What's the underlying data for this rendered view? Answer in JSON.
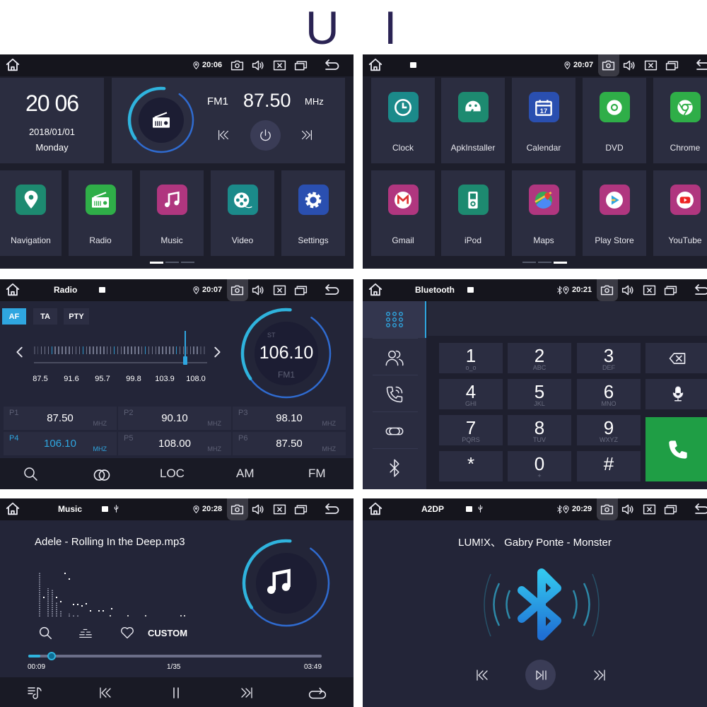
{
  "header": {
    "letters": [
      "U",
      "I"
    ]
  },
  "colors": {
    "accent": "#2fa6e0",
    "call_green": "#1f9e45",
    "status_bar": "#15151d",
    "background": "#232538",
    "tile": "#2b2d40"
  },
  "home": {
    "status": {
      "time": "20:06",
      "title": ""
    },
    "clock": {
      "time": "20 06",
      "date": "2018/01/01",
      "day": "Monday"
    },
    "radio_widget": {
      "band": "FM1",
      "frequency": "87.50",
      "unit": "MHz"
    },
    "apps": [
      {
        "label": "Navigation",
        "icon": "location-pin-icon",
        "color": "#1d8a70"
      },
      {
        "label": "Radio",
        "icon": "radio-icon",
        "color": "#2fae48"
      },
      {
        "label": "Music",
        "icon": "music-note-icon",
        "color": "#b0367f"
      },
      {
        "label": "Video",
        "icon": "film-reel-icon",
        "color": "#1b8a8a"
      },
      {
        "label": "Settings",
        "icon": "gear-icon",
        "color": "#2a4fb0"
      }
    ],
    "page_indicator": {
      "pages": 3,
      "active": 0
    }
  },
  "apps_page": {
    "status": {
      "time": "20:07",
      "title": ""
    },
    "apps": [
      {
        "label": "Clock",
        "icon": "clock-icon",
        "color": "#1b8a8a"
      },
      {
        "label": "ApkInstaller",
        "icon": "android-icon",
        "color": "#1d8a70"
      },
      {
        "label": "Calendar",
        "icon": "calendar-icon",
        "color": "#2a4fb0",
        "badge": "17"
      },
      {
        "label": "DVD",
        "icon": "disc-icon",
        "color": "#2fae48"
      },
      {
        "label": "Chrome",
        "icon": "chrome-icon",
        "color": "#2fae48"
      },
      {
        "label": "Gmail",
        "icon": "gmail-icon",
        "color": "#b0367f"
      },
      {
        "label": "iPod",
        "icon": "ipod-icon",
        "color": "#1d8a70"
      },
      {
        "label": "Maps",
        "icon": "maps-icon",
        "color": "#b0367f"
      },
      {
        "label": "Play Store",
        "icon": "play-store-icon",
        "color": "#b0367f"
      },
      {
        "label": "YouTube",
        "icon": "youtube-icon",
        "color": "#b0367f"
      }
    ],
    "page_indicator": {
      "pages": 3,
      "active": 2
    }
  },
  "radio": {
    "status": {
      "time": "20:07",
      "title": "Radio"
    },
    "options": [
      {
        "label": "AF",
        "active": true
      },
      {
        "label": "TA",
        "active": false
      },
      {
        "label": "PTY",
        "active": false
      }
    ],
    "scale_labels": [
      "87.5",
      "91.6",
      "95.7",
      "99.8",
      "103.9",
      "108.0"
    ],
    "scale_range": [
      87.5,
      108.0
    ],
    "current": {
      "frequency": "106.10",
      "value": 106.1,
      "stereo": "ST",
      "band": "FM1"
    },
    "presets": [
      {
        "slot": "P1",
        "frequency": "87.50",
        "unit": "MHZ",
        "active": false
      },
      {
        "slot": "P2",
        "frequency": "90.10",
        "unit": "MHZ",
        "active": false
      },
      {
        "slot": "P3",
        "frequency": "98.10",
        "unit": "MHZ",
        "active": false
      },
      {
        "slot": "P4",
        "frequency": "106.10",
        "unit": "MHZ",
        "active": true
      },
      {
        "slot": "P5",
        "frequency": "108.00",
        "unit": "MHZ",
        "active": false
      },
      {
        "slot": "P6",
        "frequency": "87.50",
        "unit": "MHZ",
        "active": false
      }
    ],
    "bottom": {
      "loc": "LOC",
      "am": "AM",
      "fm": "FM"
    }
  },
  "bluetooth": {
    "status": {
      "time": "20:21",
      "title": "Bluetooth"
    },
    "sidebar": [
      "dialpad-icon",
      "contacts-icon",
      "call-log-icon",
      "link-icon",
      "bluetooth-icon"
    ],
    "keys": [
      {
        "digit": "1",
        "letters": "o_o"
      },
      {
        "digit": "2",
        "letters": "ABC"
      },
      {
        "digit": "3",
        "letters": "DEF"
      },
      {
        "digit": "4",
        "letters": "GHI"
      },
      {
        "digit": "5",
        "letters": "JKL"
      },
      {
        "digit": "6",
        "letters": "MNO"
      },
      {
        "digit": "7",
        "letters": "PQRS"
      },
      {
        "digit": "8",
        "letters": "TUV"
      },
      {
        "digit": "9",
        "letters": "WXYZ"
      },
      {
        "digit": "*",
        "letters": ""
      },
      {
        "digit": "0",
        "letters": "+"
      },
      {
        "digit": "#",
        "letters": ""
      }
    ]
  },
  "music": {
    "status": {
      "time": "20:28",
      "title": "Music"
    },
    "track": "Adele - Rolling In the Deep.mp3",
    "eq_preset": "CUSTOM",
    "elapsed": "00:09",
    "index": "1/35",
    "duration": "03:49",
    "progress": 0.04
  },
  "a2dp": {
    "status": {
      "time": "20:29",
      "title": "A2DP"
    },
    "track": "LUM!X、 Gabry Ponte - Monster"
  }
}
